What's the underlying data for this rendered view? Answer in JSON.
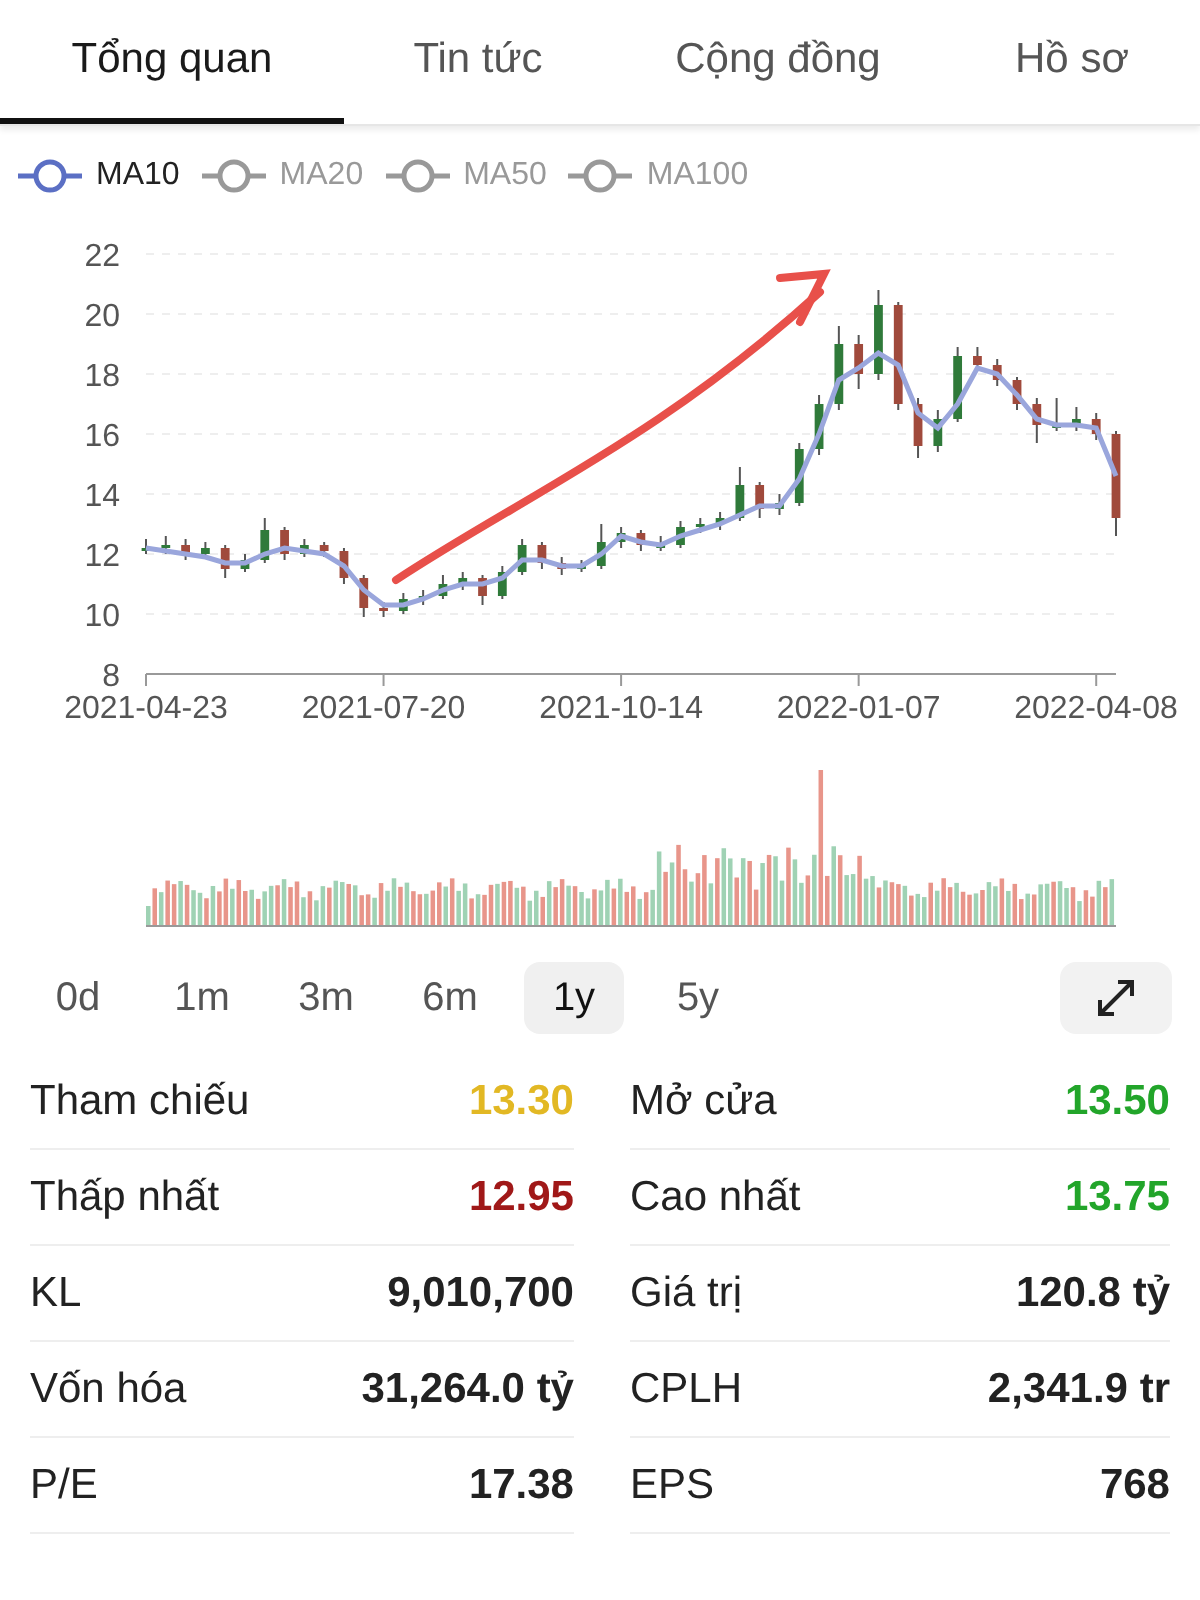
{
  "tabs": [
    {
      "label": "Tổng quan",
      "selected": true
    },
    {
      "label": "Tin tức",
      "selected": false
    },
    {
      "label": "Cộng đồng",
      "selected": false
    },
    {
      "label": "Hồ sơ",
      "selected": false
    }
  ],
  "legend": [
    {
      "selected": true
    },
    {
      "label": "MA20",
      "selected": false
    },
    {
      "label": "MA50",
      "selected": false
    },
    {
      "label": "MA100",
      "selected": false
    }
  ],
  "chart_data": {
    "type": "candlestick",
    "grid": true,
    "ylim": [
      8,
      22
    ],
    "yticks": [
      8,
      10,
      12,
      14,
      16,
      18,
      20,
      22
    ],
    "categories": [
      "2021-04-23",
      null,
      null,
      null,
      null,
      null,
      null,
      null,
      null,
      null,
      null,
      null,
      "2021-07-20",
      null,
      null,
      null,
      null,
      null,
      null,
      null,
      null,
      null,
      null,
      null,
      "2021-10-14",
      null,
      null,
      null,
      null,
      null,
      null,
      null,
      null,
      null,
      null,
      null,
      "2022-01-07",
      null,
      null,
      null,
      null,
      null,
      null,
      null,
      null,
      null,
      null,
      null,
      "2022-04-08",
      null
    ],
    "ohlc": [
      [
        12.1,
        12.5,
        12.0,
        12.2
      ],
      [
        12.2,
        12.6,
        12.0,
        12.3
      ],
      [
        12.3,
        12.5,
        11.8,
        12.0
      ],
      [
        12.0,
        12.4,
        11.9,
        12.2
      ],
      [
        12.2,
        12.3,
        11.2,
        11.5
      ],
      [
        11.5,
        12.0,
        11.4,
        11.8
      ],
      [
        11.8,
        13.2,
        11.7,
        12.8
      ],
      [
        12.8,
        12.9,
        11.8,
        12.0
      ],
      [
        12.0,
        12.5,
        11.9,
        12.3
      ],
      [
        12.3,
        12.4,
        11.9,
        12.1
      ],
      [
        12.1,
        12.2,
        11.0,
        11.2
      ],
      [
        11.2,
        11.3,
        9.9,
        10.2
      ],
      [
        10.2,
        10.4,
        9.9,
        10.1
      ],
      [
        10.1,
        10.7,
        10.0,
        10.5
      ],
      [
        10.5,
        10.8,
        10.3,
        10.6
      ],
      [
        10.6,
        11.3,
        10.5,
        11.0
      ],
      [
        11.0,
        11.4,
        10.8,
        11.2
      ],
      [
        11.2,
        11.3,
        10.3,
        10.6
      ],
      [
        10.6,
        11.6,
        10.5,
        11.4
      ],
      [
        11.4,
        12.5,
        11.3,
        12.3
      ],
      [
        12.3,
        12.4,
        11.5,
        11.7
      ],
      [
        11.7,
        11.9,
        11.3,
        11.5
      ],
      [
        11.5,
        11.8,
        11.4,
        11.6
      ],
      [
        11.6,
        13.0,
        11.5,
        12.4
      ],
      [
        12.4,
        12.9,
        12.2,
        12.7
      ],
      [
        12.7,
        12.8,
        12.1,
        12.3
      ],
      [
        12.3,
        12.6,
        12.1,
        12.3
      ],
      [
        12.3,
        13.1,
        12.2,
        12.9
      ],
      [
        12.9,
        13.2,
        12.7,
        13.0
      ],
      [
        13.0,
        13.4,
        12.8,
        13.2
      ],
      [
        13.2,
        14.9,
        13.1,
        14.3
      ],
      [
        14.3,
        14.4,
        13.2,
        13.5
      ],
      [
        13.5,
        14.0,
        13.3,
        13.7
      ],
      [
        13.7,
        15.7,
        13.6,
        15.5
      ],
      [
        15.5,
        17.3,
        15.3,
        17.0
      ],
      [
        17.0,
        19.6,
        16.8,
        19.0
      ],
      [
        19.0,
        19.3,
        17.5,
        18.0
      ],
      [
        18.0,
        20.8,
        17.8,
        20.3
      ],
      [
        20.3,
        20.4,
        16.8,
        17.0
      ],
      [
        17.0,
        17.2,
        15.2,
        15.6
      ],
      [
        15.6,
        16.8,
        15.4,
        16.5
      ],
      [
        16.5,
        18.9,
        16.4,
        18.6
      ],
      [
        18.6,
        18.9,
        18.1,
        18.3
      ],
      [
        18.3,
        18.5,
        17.6,
        17.8
      ],
      [
        17.8,
        17.9,
        16.8,
        17.0
      ],
      [
        17.0,
        17.2,
        15.7,
        16.3
      ],
      [
        16.3,
        17.2,
        16.1,
        16.3
      ],
      [
        16.3,
        16.9,
        16.1,
        16.5
      ],
      [
        16.5,
        16.7,
        15.8,
        16.0
      ],
      [
        16.0,
        16.1,
        12.6,
        13.2
      ]
    ],
    "series": [
      {
        "name": "MA10",
        "type": "line",
        "color": "#9aa6dc",
        "values": [
          12.2,
          12.1,
          12.0,
          11.9,
          11.7,
          11.7,
          12.0,
          12.2,
          12.1,
          12.0,
          11.6,
          10.8,
          10.3,
          10.3,
          10.5,
          10.8,
          11.0,
          11.0,
          11.2,
          11.8,
          11.8,
          11.6,
          11.6,
          12.0,
          12.6,
          12.4,
          12.3,
          12.6,
          12.8,
          13.0,
          13.3,
          13.6,
          13.6,
          14.5,
          16.0,
          17.8,
          18.2,
          18.7,
          18.3,
          16.7,
          16.2,
          17.0,
          18.2,
          18.0,
          17.3,
          16.5,
          16.3,
          16.3,
          16.2,
          14.6
        ]
      }
    ]
  },
  "drawn_arrow": {
    "color": "#e8504a"
  },
  "ranges": [
    {
      "label": "0d",
      "selected": false
    },
    {
      "label": "1m",
      "selected": false
    },
    {
      "label": "3m",
      "selected": false
    },
    {
      "label": "6m",
      "selected": false
    },
    {
      "label": "1y",
      "selected": true
    },
    {
      "label": "5y",
      "selected": false
    }
  ],
  "stats": [
    {
      "label": "Tham chiếu",
      "value": "13.30",
      "color": "#e2b824"
    },
    {
      "label": "Mở cửa",
      "value": "13.50",
      "color": "#22a52a"
    },
    {
      "label": "Thấp nhất",
      "value": "12.95",
      "color": "#a01818"
    },
    {
      "label": "Cao nhất",
      "value": "13.75",
      "color": "#22a52a"
    },
    {
      "label": "KL",
      "value": "9,010,700",
      "color": "#222222"
    },
    {
      "label": "Giá trị",
      "value": "120.8 tỷ",
      "color": "#222222"
    },
    {
      "label": "Vốn hóa",
      "value": "31,264.0 tỷ",
      "color": "#222222"
    },
    {
      "label": "CPLH",
      "value": "2,341.9 tr",
      "color": "#222222"
    },
    {
      "label": "P/E",
      "value": "17.38",
      "color": "#222222"
    },
    {
      "label": "EPS",
      "value": "768",
      "color": "#222222"
    }
  ]
}
